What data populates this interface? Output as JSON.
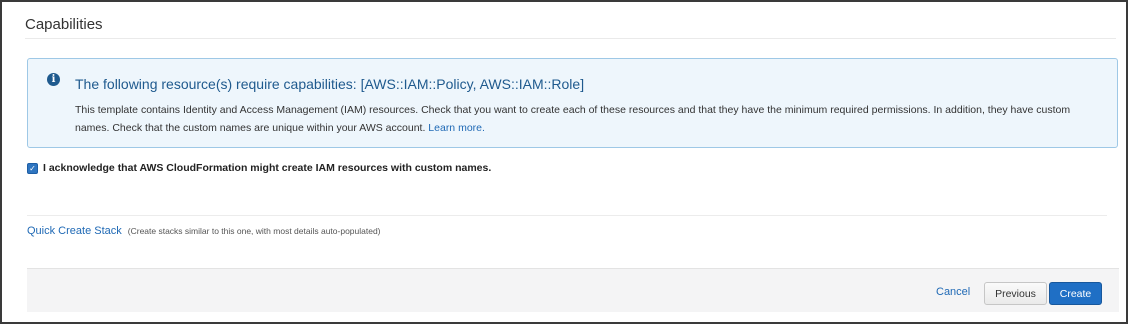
{
  "section": {
    "title": "Capabilities"
  },
  "info": {
    "icon": "info-icon",
    "icon_glyph": "i",
    "heading": "The following resource(s) require capabilities: [AWS::IAM::Policy, AWS::IAM::Role]",
    "body": "This template contains Identity and Access Management (IAM) resources. Check that you want to create each of these resources and that they have the minimum required permissions. In addition, they have custom names. Check that the custom names are unique within your AWS account.",
    "link": "Learn more."
  },
  "acknowledge": {
    "checked": true,
    "check_glyph": "✓",
    "label": "I acknowledge that AWS CloudFormation might create IAM resources with custom names."
  },
  "quick_create": {
    "link": "Quick Create Stack",
    "hint": "(Create stacks similar to this one, with most details auto-populated)"
  },
  "footer": {
    "cancel_label": "Cancel",
    "previous_label": "Previous",
    "create_label": "Create"
  },
  "colors": {
    "accent": "#1f6fc5",
    "info_background": "#eef6fc",
    "info_border": "#9ec8e6",
    "heading_text": "#1f5a8e"
  }
}
